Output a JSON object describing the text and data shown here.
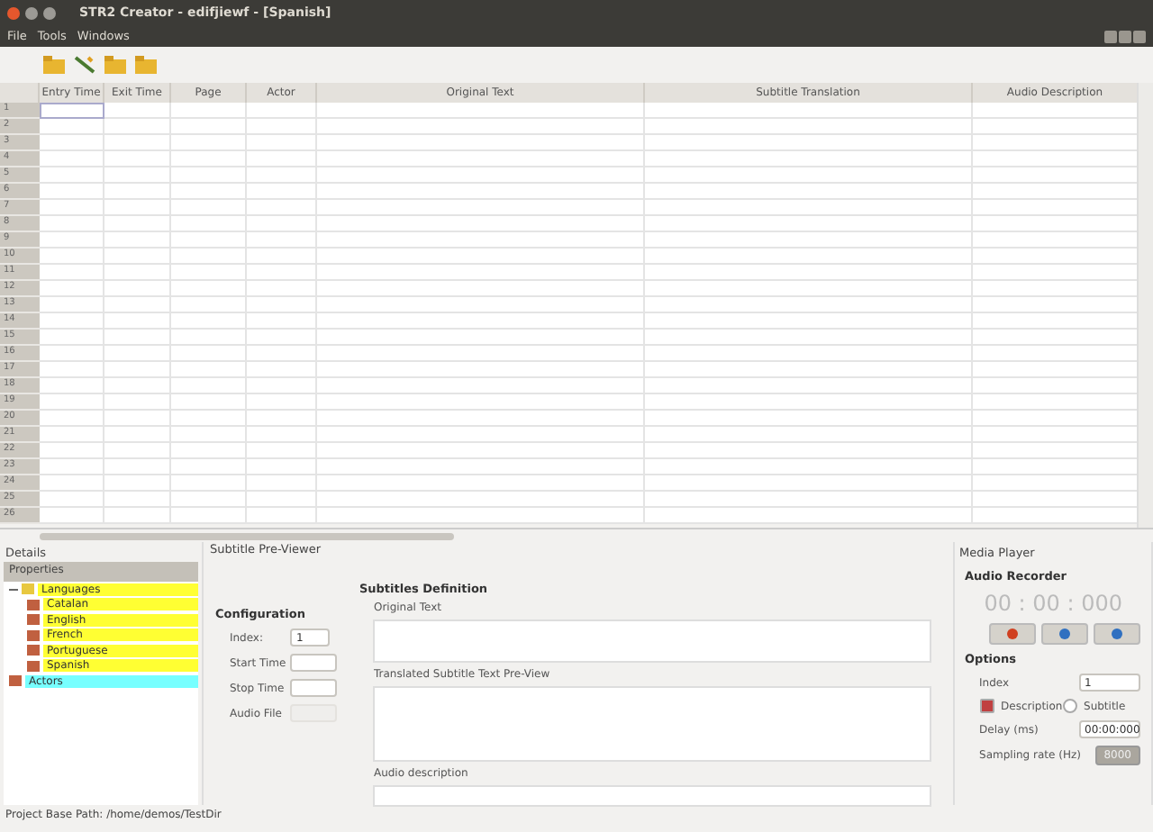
{
  "window": {
    "title": "STR2 Creator - edifjiewf - [Spanish]"
  },
  "menu": [
    "File",
    "Tools",
    "Windows"
  ],
  "toolbar": [
    {
      "kind": "folder"
    },
    {
      "kind": "wand"
    },
    {
      "kind": "folder"
    },
    {
      "kind": "folder"
    }
  ],
  "table": {
    "columns": [
      "Entry Time",
      "Exit Time",
      "Page",
      "Actor",
      "Original Text",
      "Subtitle Translation",
      "Audio Description"
    ],
    "rows": [
      "1",
      "2",
      "3",
      "4",
      "5",
      "6",
      "7",
      "8",
      "9",
      "10",
      "11",
      "12",
      "13",
      "14",
      "15",
      "16",
      "17",
      "18",
      "19",
      "20",
      "21",
      "22",
      "23",
      "24",
      "25",
      "26"
    ]
  },
  "details": {
    "title": "Details",
    "header": "Properties",
    "tree": [
      {
        "label": "Languages",
        "color": "#ffff33",
        "expanded": true,
        "children": [
          {
            "label": "Catalan",
            "color": "#ffff33"
          },
          {
            "label": "English",
            "color": "#ffff33"
          },
          {
            "label": "French",
            "color": "#ffff33"
          },
          {
            "label": "Portuguese",
            "color": "#ffff33"
          },
          {
            "label": "Spanish",
            "color": "#ffff33"
          }
        ]
      },
      {
        "label": "Actors",
        "color": "#77ffff"
      }
    ]
  },
  "previewer": {
    "title": "Subtitle Pre-Viewer",
    "configuration": {
      "title": "Configuration",
      "index_label": "Index:",
      "index": "1",
      "start_label": "Start Time",
      "stop_label": "Stop Time",
      "audio_label": "Audio File"
    },
    "definition": {
      "title": "Subtitles Definition",
      "original_label": "Original Text",
      "translated_label": "Translated Subtitle Text Pre-View",
      "audio_label": "Audio description"
    }
  },
  "media_player": {
    "title": "Media Player",
    "recorder_title": "Audio Recorder",
    "time": "00 : 00 : 000",
    "options_title": "Options",
    "index_label": "Index",
    "index": "1",
    "description": {
      "label": "Description",
      "checked": true
    },
    "subtitle": {
      "label": "Subtitle",
      "checked": false
    },
    "delay_label": "Delay (ms)",
    "delay": "00:00:000",
    "rate_label": "Sampling rate (Hz)",
    "rate": "8000"
  },
  "status_bar": "Project Base Path: /home/demos/TestDir"
}
